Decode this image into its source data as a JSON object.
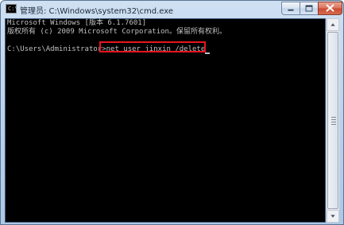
{
  "window": {
    "title": "管理员: C:\\Windows\\system32\\cmd.exe",
    "icon": "cmd-icon"
  },
  "console": {
    "lines": [
      "Microsoft Windows [版本 6.1.7601]",
      "版权所有 (c) 2009 Microsoft Corporation。保留所有权利。",
      ""
    ],
    "prompt": "C:\\Users\\Administrator>",
    "command": "net user jinxin /delete"
  },
  "colors": {
    "console_background": "#000000",
    "console_text": "#c0c0c0",
    "highlight_border": "#e8141e",
    "close_button": "#c84a2f"
  },
  "caption_buttons": [
    "minimize-icon",
    "maximize-icon",
    "close-icon"
  ]
}
